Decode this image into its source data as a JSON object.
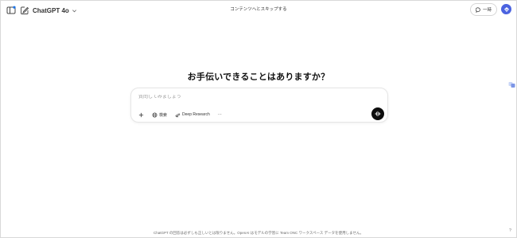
{
  "header": {
    "model_name": "ChatGPT 4o",
    "skip_link": "コンテンツへとスキップする",
    "temporary_chat_label": "一時"
  },
  "main": {
    "headline": "お手伝いできることはありますか？",
    "composer": {
      "placeholder": "質問してみましょう",
      "tools": {
        "search_label": "検索",
        "deep_research_label": "Deep Research",
        "more_label": "···"
      }
    }
  },
  "footer": {
    "disclaimer": "ChatGPT の回答は必ずしも正しいとは限りません。OpenAI はモデルの学習に Team ONC ワークスペース データを使用しません。",
    "help": "?"
  },
  "colors": {
    "avatar": "#4b63e0",
    "voice_button": "#0d0d0d",
    "sidebar_icon_accent": "#1a73e8"
  },
  "icons": [
    "sidebar-toggle-icon",
    "new-chat-icon",
    "chevron-down-icon",
    "chat-bubble-icon",
    "avatar-logo-icon",
    "translate-icon",
    "plus-icon",
    "globe-icon",
    "telescope-icon",
    "ellipsis-icon",
    "voice-wave-icon"
  ]
}
